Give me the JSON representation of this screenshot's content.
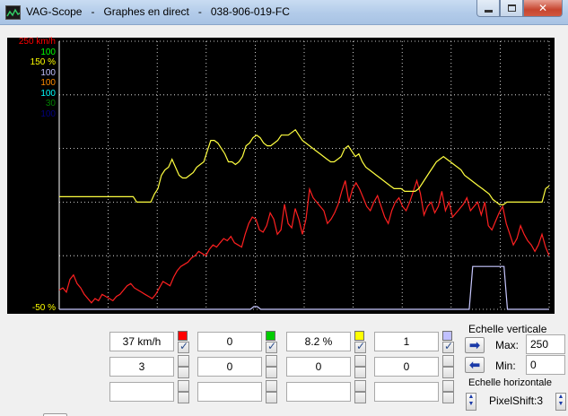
{
  "window": {
    "title": "VAG-Scope   -   Graphes en direct   -   038-906-019-FC",
    "minimize_label": "",
    "maximize_label": "",
    "close_label": "✕"
  },
  "plot": {
    "scale_labels": [
      {
        "text": "250 km/h",
        "color": "#ff0000"
      },
      {
        "text": "100",
        "color": "#00ff00"
      },
      {
        "text": "150 %",
        "color": "#ffff00"
      },
      {
        "text": "100",
        "color": "#c0c0ff"
      },
      {
        "text": "100",
        "color": "#ff8c00"
      },
      {
        "text": "100",
        "color": "#00ffff"
      },
      {
        "text": "30",
        "color": "#008000"
      },
      {
        "text": "100",
        "color": "#000080"
      }
    ],
    "bottom_label": {
      "text": "-50 %",
      "color": "#ffff00"
    },
    "grid_color": "#ffffff"
  },
  "chart_data": {
    "type": "line",
    "series": [
      {
        "color": "#ff2020",
        "unit": "km/h",
        "range": [
          0,
          250
        ],
        "values": [
          18,
          20,
          16,
          28,
          32,
          24,
          20,
          14,
          10,
          6,
          10,
          8,
          14,
          12,
          10,
          8,
          12,
          14,
          18,
          22,
          24,
          20,
          18,
          16,
          14,
          12,
          10,
          14,
          20,
          26,
          24,
          22,
          30,
          36,
          40,
          42,
          44,
          48,
          50,
          54,
          52,
          50,
          56,
          60,
          58,
          62,
          66,
          64,
          68,
          62,
          60,
          58,
          70,
          80,
          86,
          84,
          74,
          72,
          78,
          90,
          84,
          70,
          74,
          98,
          80,
          76,
          94,
          84,
          70,
          84,
          112,
          104,
          100,
          96,
          92,
          80,
          84,
          90,
          98,
          110,
          120,
          100,
          112,
          118,
          112,
          104,
          96,
          92,
          100,
          106,
          96,
          86,
          80,
          92,
          100,
          104,
          96,
          92,
          100,
          110,
          120,
          108,
          88,
          96,
          100,
          90,
          96,
          110,
          92,
          100,
          86,
          90,
          94,
          98,
          104,
          92,
          96,
          100,
          88,
          100,
          78,
          74,
          82,
          90,
          96,
          80,
          70,
          60,
          66,
          78,
          70,
          64,
          60,
          54,
          60,
          70,
          58,
          50
        ]
      },
      {
        "color": "#ffff40",
        "unit": "%",
        "range": [
          -50,
          150
        ],
        "values": [
          34,
          34,
          34,
          34,
          34,
          34,
          34,
          34,
          34,
          34,
          34,
          34,
          34,
          34,
          34,
          34,
          34,
          34,
          34,
          34,
          34,
          34,
          30,
          30,
          30,
          30,
          30,
          36,
          40,
          50,
          54,
          56,
          62,
          56,
          50,
          48,
          48,
          50,
          52,
          56,
          58,
          60,
          68,
          76,
          76,
          74,
          70,
          66,
          60,
          60,
          58,
          60,
          64,
          72,
          74,
          78,
          80,
          78,
          74,
          72,
          72,
          74,
          76,
          80,
          80,
          80,
          82,
          84,
          80,
          76,
          74,
          72,
          70,
          68,
          66,
          64,
          62,
          60,
          60,
          62,
          64,
          70,
          72,
          68,
          64,
          66,
          60,
          56,
          54,
          52,
          50,
          48,
          46,
          44,
          42,
          40,
          40,
          40,
          38,
          38,
          38,
          38,
          40,
          44,
          48,
          52,
          56,
          60,
          62,
          64,
          62,
          60,
          58,
          56,
          54,
          50,
          48,
          46,
          44,
          42,
          40,
          38,
          36,
          32,
          30,
          28,
          28,
          30,
          30,
          30,
          30,
          30,
          30,
          30,
          30,
          30,
          30,
          30,
          40,
          42
        ]
      },
      {
        "color": "#c8c8ff",
        "unit": "",
        "range": [
          0,
          100
        ],
        "values": [
          0,
          0,
          0,
          0,
          0,
          0,
          0,
          0,
          0,
          0,
          0,
          0,
          0,
          0,
          0,
          0,
          0,
          0,
          0,
          0,
          0,
          0,
          0,
          0,
          0,
          0,
          0,
          0,
          0,
          0,
          0,
          0,
          0,
          0,
          0,
          0,
          0,
          0,
          0,
          0,
          0,
          0,
          0,
          0,
          0,
          0,
          0,
          0,
          0,
          0,
          0,
          0,
          0,
          0,
          0,
          0,
          1,
          1,
          0,
          0,
          0,
          0,
          0,
          0,
          0,
          0,
          0,
          0,
          0,
          0,
          0,
          0,
          0,
          0,
          0,
          0,
          0,
          0,
          0,
          0,
          0,
          0,
          0,
          0,
          0,
          0,
          0,
          0,
          0,
          0,
          0,
          0,
          0,
          0,
          0,
          0,
          0,
          0,
          0,
          0,
          0,
          0,
          0,
          0,
          0,
          0,
          0,
          0,
          0,
          0,
          0,
          0,
          0,
          0,
          0,
          0,
          0,
          0,
          0,
          16,
          16,
          16,
          16,
          16,
          16,
          16,
          16,
          16,
          16,
          0,
          0,
          0,
          0,
          0,
          0,
          0,
          0,
          0,
          0,
          0,
          0,
          0
        ]
      }
    ]
  },
  "channels": [
    {
      "value": "37 km/h",
      "color": "#ff0000",
      "checked": true
    },
    {
      "value": "0",
      "color": "#00cc00",
      "checked": true
    },
    {
      "value": "8.2 %",
      "color": "#ffff00",
      "checked": true
    },
    {
      "value": "1",
      "color": "#c0c0ff",
      "checked": true
    },
    {
      "value": "3",
      "color": "",
      "checked": false
    },
    {
      "value": "0",
      "color": "",
      "checked": false
    },
    {
      "value": "0",
      "color": "",
      "checked": false
    },
    {
      "value": "0",
      "color": "",
      "checked": false
    },
    {
      "value": "",
      "color": "",
      "checked": false
    },
    {
      "value": "",
      "color": "",
      "checked": false
    },
    {
      "value": "",
      "color": "",
      "checked": false
    },
    {
      "value": "",
      "color": "",
      "checked": false
    }
  ],
  "vertical_scale": {
    "label": "Echelle verticale",
    "max_label": "Max:",
    "max_value": "250",
    "min_label": "Min:",
    "min_value": "0",
    "right_arrow": "➡",
    "left_arrow": "⬅"
  },
  "horizontal_scale": {
    "label": "Echelle horizontale",
    "pixelshift": "PixelShift:3",
    "spin_up": "▲",
    "spin_down": "▼"
  },
  "icons": {
    "play": "play-icon",
    "app": "scope-icon"
  }
}
